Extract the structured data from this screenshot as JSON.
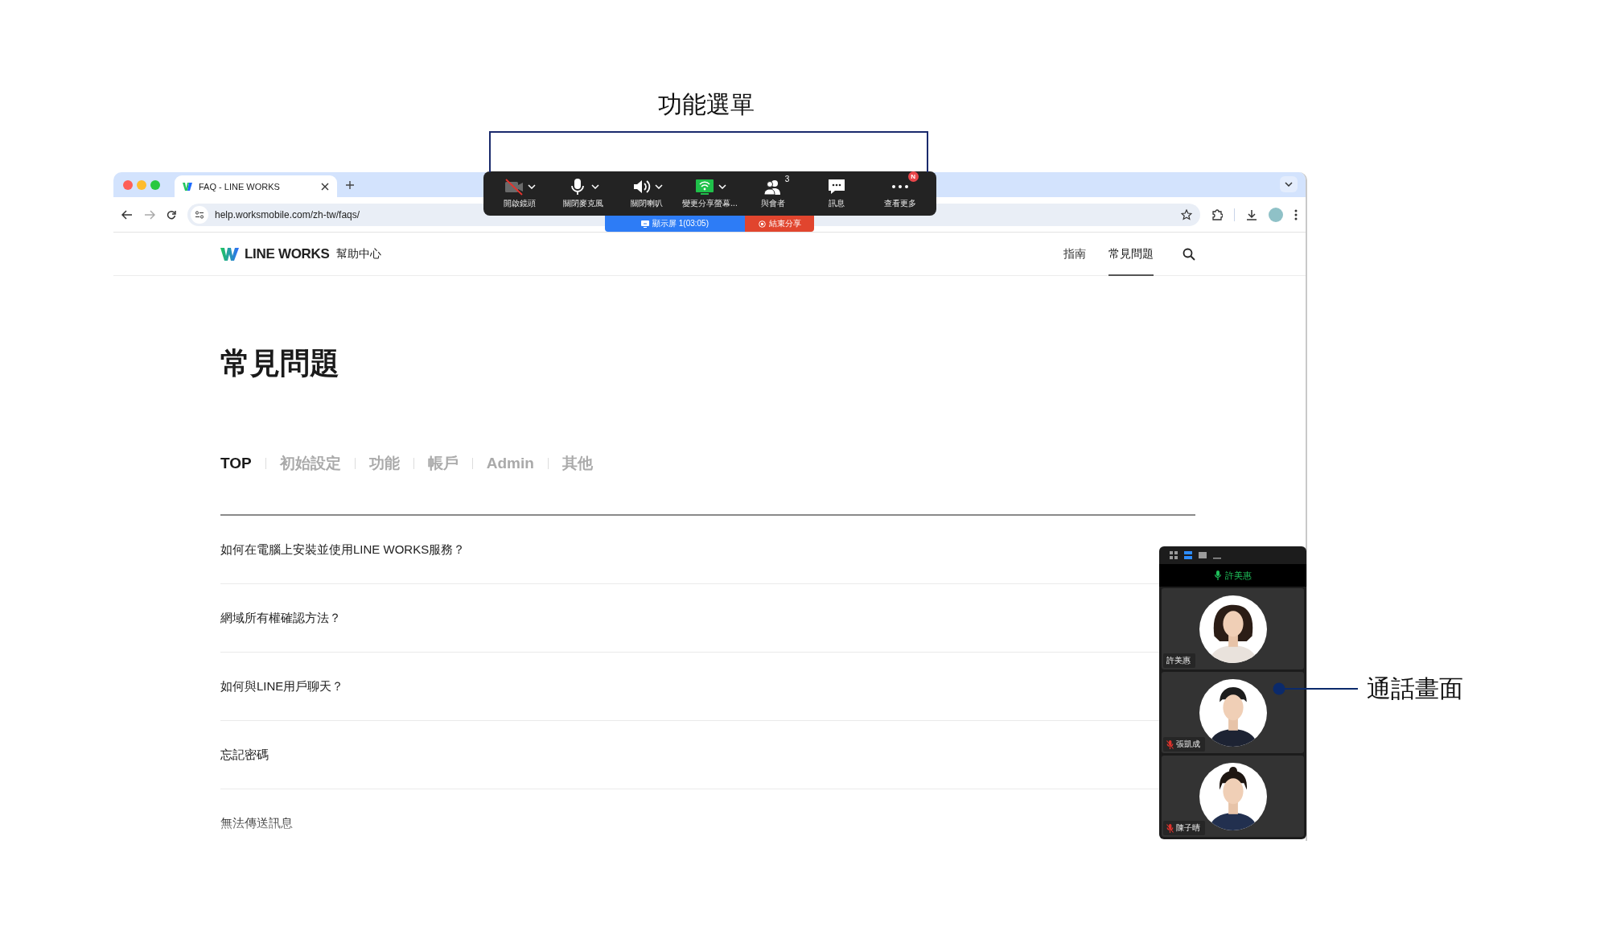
{
  "annotations": [
    {
      "kind": "bracket",
      "label": "功能選單"
    },
    {
      "kind": "pointer",
      "label": "通話畫面"
    }
  ],
  "browser": {
    "tab": {
      "title": "FAQ - LINE WORKS"
    },
    "url": "help.worksmobile.com/zh-tw/faqs/"
  },
  "site": {
    "brand": "LINE WORKS",
    "subtitle": "幫助中心",
    "nav": [
      {
        "label": "指南",
        "selected": false
      },
      {
        "label": "常見問題",
        "selected": true
      }
    ]
  },
  "page": {
    "title": "常見問題",
    "categories": [
      {
        "label": "TOP",
        "selected": true
      },
      {
        "label": "初始設定",
        "selected": false
      },
      {
        "label": "功能",
        "selected": false
      },
      {
        "label": "帳戶",
        "selected": false
      },
      {
        "label": "Admin",
        "selected": false
      },
      {
        "label": "其他",
        "selected": false
      }
    ],
    "faqs": [
      "如何在電腦上安裝並使用LINE WORKS服務？",
      "網域所有權確認方法？",
      "如何與LINE用戶聊天？",
      "忘記密碼",
      "無法傳送訊息"
    ]
  },
  "meeting_toolbar": {
    "buttons": [
      {
        "kind": "camera",
        "label": "開啟鏡頭",
        "dropdown": true,
        "off": true
      },
      {
        "kind": "mic",
        "label": "關閉麥克風",
        "dropdown": true,
        "off": false
      },
      {
        "kind": "speaker",
        "label": "關閉喇叭",
        "dropdown": true,
        "off": false
      },
      {
        "kind": "share",
        "label": "變更分享螢幕...",
        "dropdown": true,
        "off": false
      },
      {
        "kind": "participants",
        "label": "與會者",
        "dropdown": false,
        "off": false,
        "count": "3"
      },
      {
        "kind": "chat",
        "label": "訊息",
        "dropdown": false,
        "off": false
      },
      {
        "kind": "more",
        "label": "查看更多",
        "dropdown": false,
        "off": false,
        "badge": "N"
      }
    ],
    "screen_status": "顯示屏 1(03:05)",
    "stop_share": "結束分享"
  },
  "video_panel": {
    "view_modes": [
      {
        "kind": "grid",
        "selected": false
      },
      {
        "kind": "stack",
        "selected": true
      },
      {
        "kind": "single",
        "selected": false
      },
      {
        "kind": "minimize",
        "selected": false
      }
    ],
    "speaker": "許美惠",
    "tiles": [
      {
        "name": "許美惠",
        "muted": false
      },
      {
        "name": "張凱成",
        "muted": true
      },
      {
        "name": "陳子晴",
        "muted": true
      }
    ]
  }
}
